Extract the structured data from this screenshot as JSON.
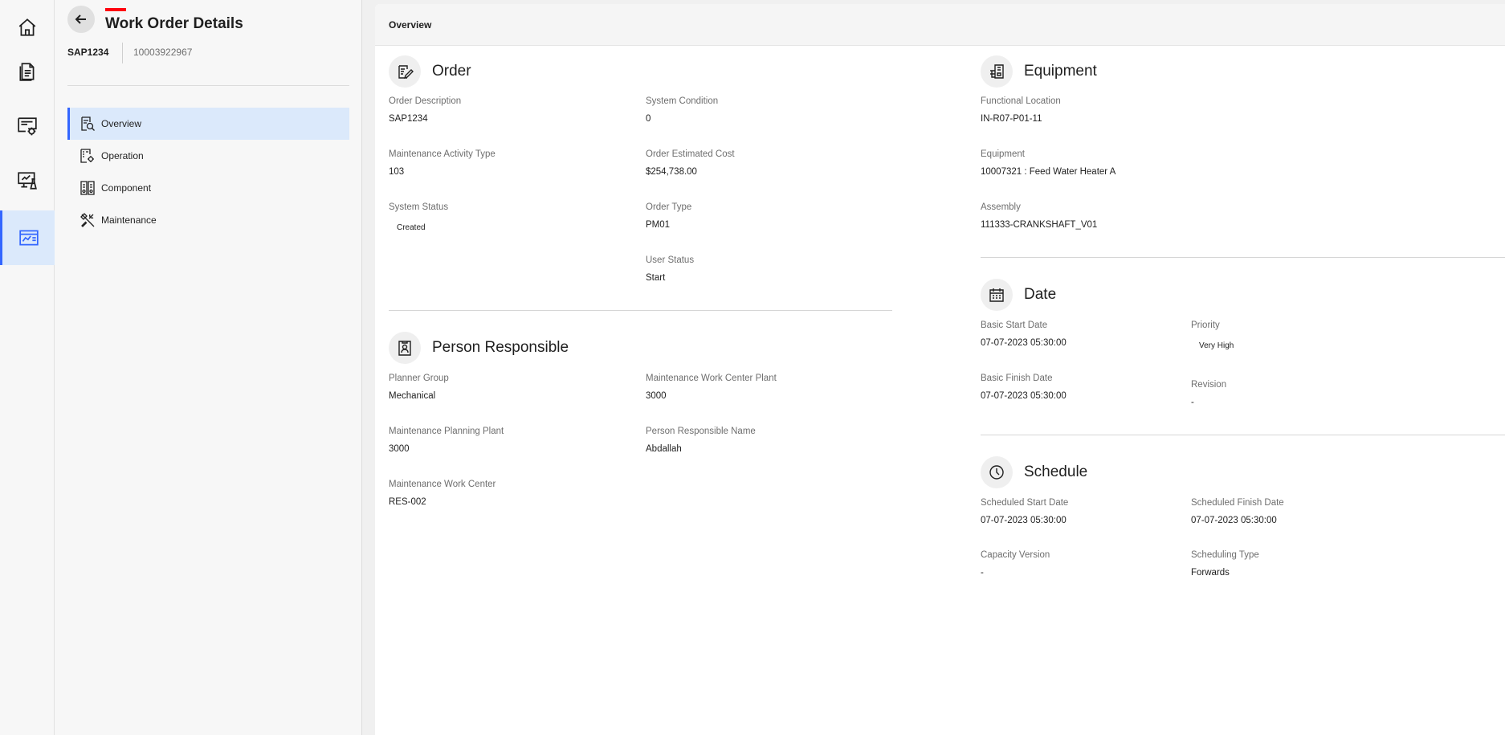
{
  "rail": {
    "items": [
      {
        "name": "home"
      },
      {
        "name": "documents"
      },
      {
        "name": "work-settings"
      },
      {
        "name": "monitor-lab"
      },
      {
        "name": "dashboard",
        "active": true
      }
    ]
  },
  "header": {
    "title": "Work Order Details",
    "order_id": "SAP1234",
    "order_number": "10003922967"
  },
  "subnav": {
    "items": [
      {
        "label": "Overview",
        "icon": "overview-icon",
        "active": true
      },
      {
        "label": "Operation",
        "icon": "operation-icon"
      },
      {
        "label": "Component",
        "icon": "component-icon"
      },
      {
        "label": "Maintenance",
        "icon": "maintenance-icon"
      }
    ]
  },
  "main": {
    "tab": "Overview",
    "order": {
      "title": "Order",
      "order_description": {
        "label": "Order Description",
        "value": "SAP1234"
      },
      "system_condition": {
        "label": "System Condition",
        "value": "0"
      },
      "activity_type": {
        "label": "Maintenance Activity Type",
        "value": "103"
      },
      "estimated_cost": {
        "label": "Order Estimated Cost",
        "value": "$254,738.00"
      },
      "system_status": {
        "label": "System Status",
        "value": "Created"
      },
      "order_type": {
        "label": "Order Type",
        "value": "PM01"
      },
      "user_status": {
        "label": "User Status",
        "value": "Start"
      }
    },
    "person": {
      "title": "Person Responsible",
      "planner_group": {
        "label": "Planner Group",
        "value": "Mechanical"
      },
      "work_center_plant": {
        "label": "Maintenance Work Center Plant",
        "value": "3000"
      },
      "planning_plant": {
        "label": "Maintenance Planning Plant",
        "value": "3000"
      },
      "person_name": {
        "label": "Person Responsible Name",
        "value": "Abdallah"
      },
      "work_center": {
        "label": "Maintenance Work Center",
        "value": "RES-002"
      }
    },
    "equipment": {
      "title": "Equipment",
      "functional_location": {
        "label": "Functional Location",
        "value": "IN-R07-P01-11"
      },
      "equipment": {
        "label": "Equipment",
        "value": "10007321 : Feed Water Heater A"
      },
      "assembly": {
        "label": "Assembly",
        "value": "111333-CRANKSHAFT_V01"
      }
    },
    "date": {
      "title": "Date",
      "basic_start": {
        "label": "Basic Start Date",
        "value": "07-07-2023 05:30:00"
      },
      "priority": {
        "label": "Priority",
        "value": "Very High"
      },
      "basic_finish": {
        "label": "Basic Finish Date",
        "value": "07-07-2023 05:30:00"
      },
      "revision": {
        "label": "Revision",
        "value": "-"
      }
    },
    "schedule": {
      "title": "Schedule",
      "scheduled_start": {
        "label": "Scheduled Start Date",
        "value": "07-07-2023 05:30:00"
      },
      "scheduled_finish": {
        "label": "Scheduled Finish Date",
        "value": "07-07-2023 05:30:00"
      },
      "capacity_version": {
        "label": "Capacity Version",
        "value": "-"
      },
      "scheduling_type": {
        "label": "Scheduling Type",
        "value": "Forwards"
      }
    }
  }
}
